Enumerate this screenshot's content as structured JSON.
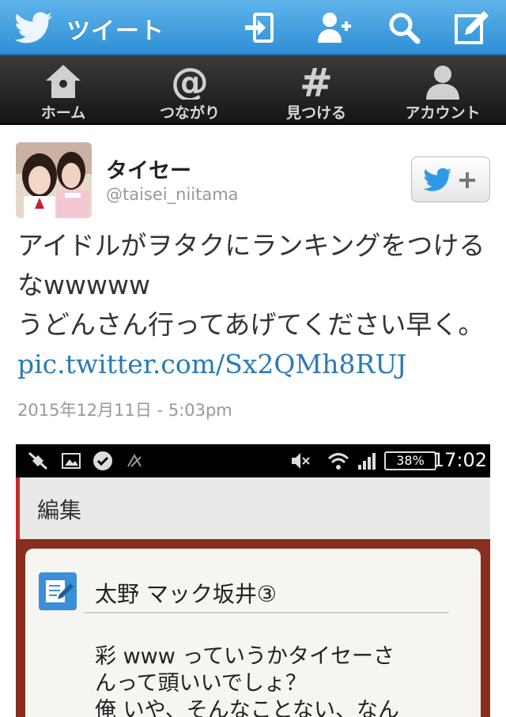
{
  "header": {
    "title": "ツイート",
    "icons": [
      "twitter-bird-icon",
      "sign-in-icon",
      "add-user-icon",
      "search-icon",
      "compose-icon"
    ]
  },
  "nav": {
    "items": [
      {
        "label": "ホーム",
        "icon": "home-icon"
      },
      {
        "label": "つながり",
        "icon": "at-icon"
      },
      {
        "label": "見つける",
        "icon": "hashtag-icon"
      },
      {
        "label": "アカウント",
        "icon": "account-icon"
      }
    ]
  },
  "tweet": {
    "name": "タイセー",
    "handle": "@taisei_niitama",
    "line1": "アイドルがヲタクにランキングをつけるなwwwww",
    "line2": "うどんさん行ってあげてください早く。",
    "link": "pic.twitter.com/Sx2QMh8RUJ",
    "timestamp": "2015年12月11日 - 5:03pm"
  },
  "embedded_image": {
    "status_bar": {
      "battery": "38%",
      "time": "17:02"
    },
    "header": "編集",
    "contact_name": "太野 マック坂井③",
    "body_line1": "彩 www っていうかタイセーさ",
    "body_line2": "んって頭いいでしょ？",
    "body_line3": "俺 いや、そんなことない、なん"
  },
  "colors": {
    "header_blue": "#2f8fd6",
    "nav_dark": "#1f1f1f",
    "link_blue": "#2a7ab5",
    "follow_bird": "#2e9ae6"
  }
}
